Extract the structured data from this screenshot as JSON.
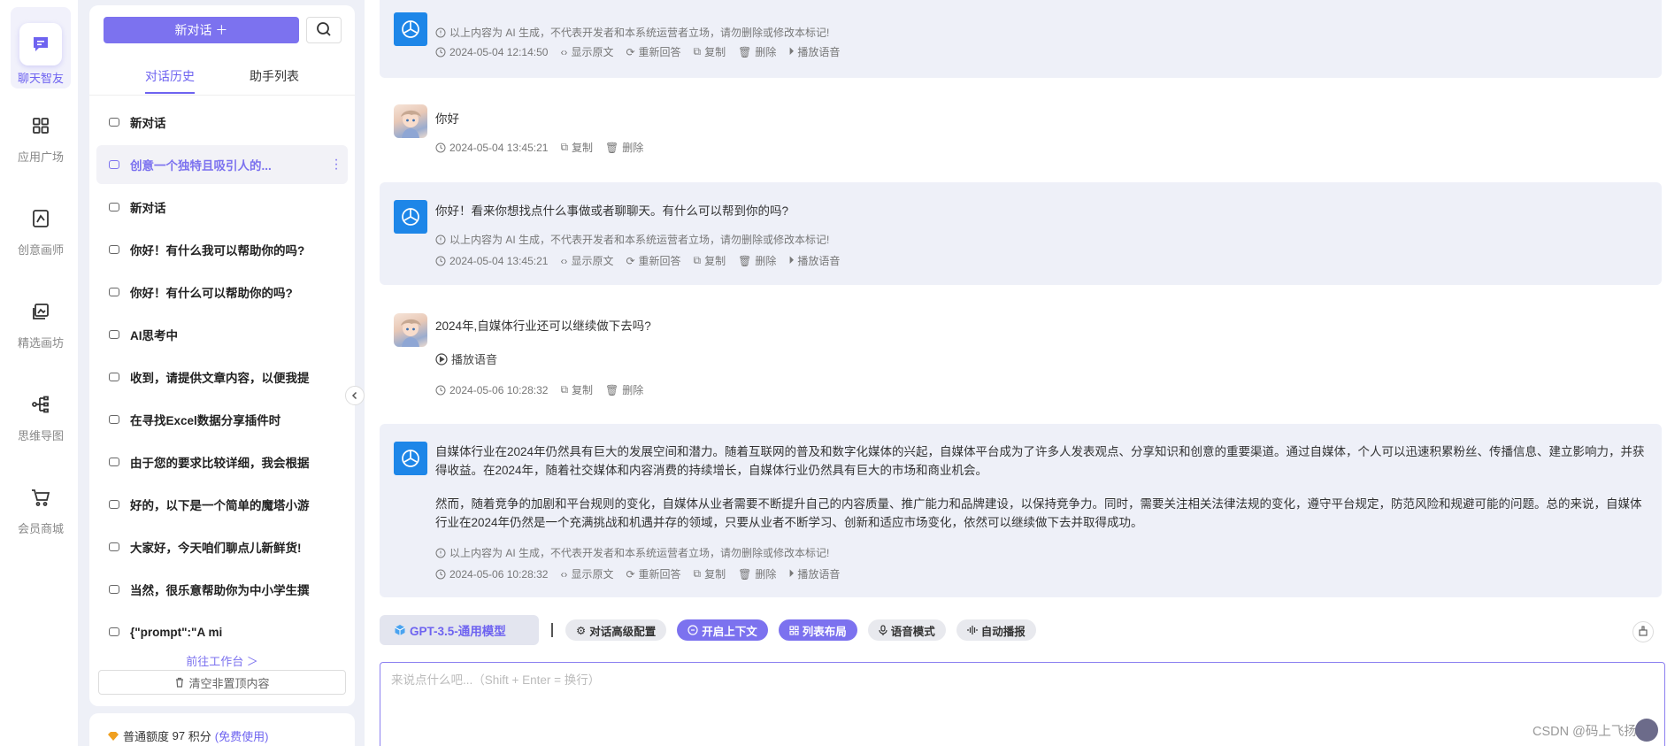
{
  "rail": {
    "items": [
      {
        "label": "聊天智友",
        "icon": "chat-icon",
        "active": true
      },
      {
        "label": "应用广场",
        "icon": "grid-icon"
      },
      {
        "label": "创意画师",
        "icon": "canvas-icon"
      },
      {
        "label": "精选画坊",
        "icon": "gallery-icon"
      },
      {
        "label": "思维导图",
        "icon": "mindmap-icon"
      },
      {
        "label": "会员商城",
        "icon": "cart-icon"
      }
    ]
  },
  "sidebar": {
    "new_chat_label": "新对话 ＋",
    "tabs": [
      {
        "label": "对话历史",
        "active": true
      },
      {
        "label": "助手列表"
      }
    ],
    "history": [
      {
        "label": "新对话"
      },
      {
        "label": "创意一个独特且吸引人的...",
        "active": true
      },
      {
        "label": "新对话"
      },
      {
        "label": "你好！有什么我可以帮助你的吗?"
      },
      {
        "label": "你好！有什么可以帮助你的吗?"
      },
      {
        "label": "AI思考中"
      },
      {
        "label": "收到，请提供文章内容，以便我提"
      },
      {
        "label": "在寻找Excel数据分享插件时"
      },
      {
        "label": "由于您的要求比较详细，我会根据"
      },
      {
        "label": "好的，以下是一个简单的魔塔小游"
      },
      {
        "label": "大家好，今天咱们聊点儿新鲜货!"
      },
      {
        "label": "当然，很乐意帮助你为中小学生撰"
      },
      {
        "label": "{\"prompt\":\"A mi"
      }
    ],
    "goto_label": "前往工作台 ＞",
    "clear_label": "清空非置顶内容",
    "quota": {
      "label": "普通额度",
      "value": "97",
      "unit": "积分",
      "free": "(免费使用)"
    }
  },
  "chat": {
    "messages": [
      {
        "role": "ai",
        "disclaimer": "以上内容为 AI 生成，不代表开发者和本系统运营者立场，请勿删除或修改本标记!",
        "time": "2024-05-04 12:14:50",
        "actions": [
          "显示原文",
          "重新回答",
          "复制",
          "删除",
          "播放语音"
        ]
      },
      {
        "role": "user",
        "text": "你好",
        "time": "2024-05-04 13:45:21",
        "actions": [
          "复制",
          "删除"
        ]
      },
      {
        "role": "ai",
        "text": "你好！看来你想找点什么事做或者聊聊天。有什么可以帮到你的吗?",
        "disclaimer": "以上内容为 AI 生成，不代表开发者和本系统运营者立场，请勿删除或修改本标记!",
        "time": "2024-05-04 13:45:21",
        "actions": [
          "显示原文",
          "重新回答",
          "复制",
          "删除",
          "播放语音"
        ]
      },
      {
        "role": "user",
        "text": "2024年,自媒体行业还可以继续做下去吗?",
        "play_label": "播放语音",
        "time": "2024-05-06 10:28:32",
        "actions": [
          "复制",
          "删除"
        ]
      },
      {
        "role": "ai",
        "paragraphs": [
          "自媒体行业在2024年仍然具有巨大的发展空间和潜力。随着互联网的普及和数字化媒体的兴起，自媒体平台成为了许多人发表观点、分享知识和创意的重要渠道。通过自媒体，个人可以迅速积累粉丝、传播信息、建立影响力，并获得收益。在2024年，随着社交媒体和内容消费的持续增长，自媒体行业仍然具有巨大的市场和商业机会。",
          "然而，随着竞争的加剧和平台规则的变化，自媒体从业者需要不断提升自己的内容质量、推广能力和品牌建设，以保持竞争力。同时，需要关注相关法律法规的变化，遵守平台规定，防范风险和规避可能的问题。总的来说，自媒体行业在2024年仍然是一个充满挑战和机遇并存的领域，只要从业者不断学习、创新和适应市场变化，依然可以继续做下去并取得成功。"
        ],
        "disclaimer": "以上内容为 AI 生成，不代表开发者和本系统运营者立场，请勿删除或修改本标记!",
        "time": "2024-05-06 10:28:32",
        "actions": [
          "显示原文",
          "重新回答",
          "复制",
          "删除",
          "播放语音"
        ]
      }
    ]
  },
  "toolbar": {
    "model": "GPT-3.5-通用模型",
    "buttons": [
      {
        "label": "对话高级配置",
        "style": "gray"
      },
      {
        "label": "开启上下文",
        "style": "purple"
      },
      {
        "label": "列表布局",
        "style": "purple"
      },
      {
        "label": "语音模式",
        "style": "gray"
      },
      {
        "label": "自动播报",
        "style": "gray"
      }
    ]
  },
  "input": {
    "placeholder": "来说点什么吧...（Shift + Enter = 换行）"
  },
  "watermark": "CSDN @码上飞扬",
  "colors": {
    "accent": "#7c72ef",
    "ai_bg": "#eef0f8",
    "ai_logo": "#1d86e8"
  }
}
